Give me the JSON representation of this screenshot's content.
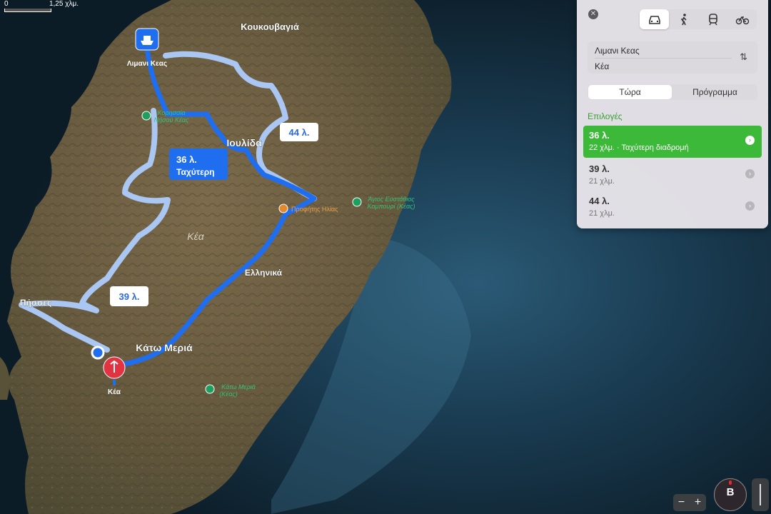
{
  "scale": {
    "start": "0",
    "end": "1,25 χλμ."
  },
  "map": {
    "places": {
      "koukouvagia": "Κουκουβαγιά",
      "limani_keas": "Λιμανι Κεας",
      "ioulida": "Ιουλίδα",
      "kea_region": "Κέα",
      "ellinika": "Ελληνικά",
      "pisses": "Πήσσες",
      "kato_meria": "Κάτω Μεριά",
      "kea_pin": "Κέα"
    },
    "pois": {
      "korissia": "Κορησσία\nΝήσου Κέας",
      "profitis_ilias": "Προφήτης Ηλίας",
      "agios_efstathios": "Άγιος Ευστάθιος\nΚαμπουρί (Κέας)",
      "kato_meria_poi": "Κάτω Μεριά\n(Κέας)"
    },
    "callouts": {
      "c44": "44 λ.",
      "c39": "39 λ.",
      "c36_time": "36 λ.",
      "c36_label": "Ταχύτερη"
    }
  },
  "panel": {
    "close": "✕",
    "modes": [
      "car-icon",
      "walk-icon",
      "transit-icon",
      "bike-icon"
    ],
    "from": "Λιμανι Κεας",
    "to": "Κέα",
    "tabs": {
      "now": "Τώρα",
      "schedule": "Πρόγραμμα"
    },
    "options_title": "Επιλογές",
    "options": [
      {
        "time": "36 λ.",
        "detail": "22 χλμ. · Ταχύτερη διαδρομή",
        "selected": true
      },
      {
        "time": "39 λ.",
        "detail": "21 χλμ.",
        "selected": false
      },
      {
        "time": "44 λ.",
        "detail": "21 χλμ.",
        "selected": false
      }
    ]
  },
  "controls": {
    "zoom_out": "−",
    "zoom_in": "+",
    "compass": "B"
  },
  "colors": {
    "route_primary": "#1f6ef0",
    "route_alt": "#a9c7f2",
    "selected": "#3db93a",
    "pin": "#e23341"
  }
}
